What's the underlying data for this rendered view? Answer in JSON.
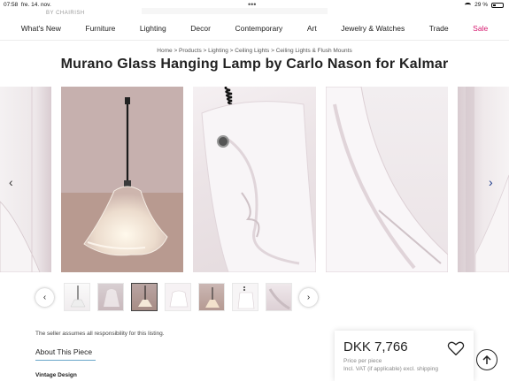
{
  "status": {
    "time": "07:58",
    "date": "fre. 14. nov.",
    "battery": "29 %"
  },
  "brand_sub": "BY CHAIRISH",
  "nav": [
    {
      "label": "What's New"
    },
    {
      "label": "Furniture"
    },
    {
      "label": "Lighting"
    },
    {
      "label": "Decor"
    },
    {
      "label": "Contemporary"
    },
    {
      "label": "Art"
    },
    {
      "label": "Jewelry & Watches"
    },
    {
      "label": "Trade"
    },
    {
      "label": "Sale"
    }
  ],
  "breadcrumb": "Home > Products > Lighting > Ceiling Lights > Ceiling Lights & Flush Mounts",
  "product": {
    "title": "Murano Glass Hanging Lamp by Carlo Nason for Kalmar"
  },
  "carousel": {
    "prev_icon": "chevron-left-icon",
    "next_icon": "chevron-right-icon"
  },
  "thumbnails": {
    "count": 7
  },
  "seller_note": "The seller assumes all responsibility for this listing.",
  "about": {
    "heading": "About This Piece",
    "subheading": "Vintage Design"
  },
  "price": {
    "amount": "DKK 7,766",
    "per": "Price per piece",
    "vat": "Incl. VAT (if applicable) excl. shipping"
  },
  "colors": {
    "sale": "#d6196f",
    "underline": "#6aa6c9"
  }
}
